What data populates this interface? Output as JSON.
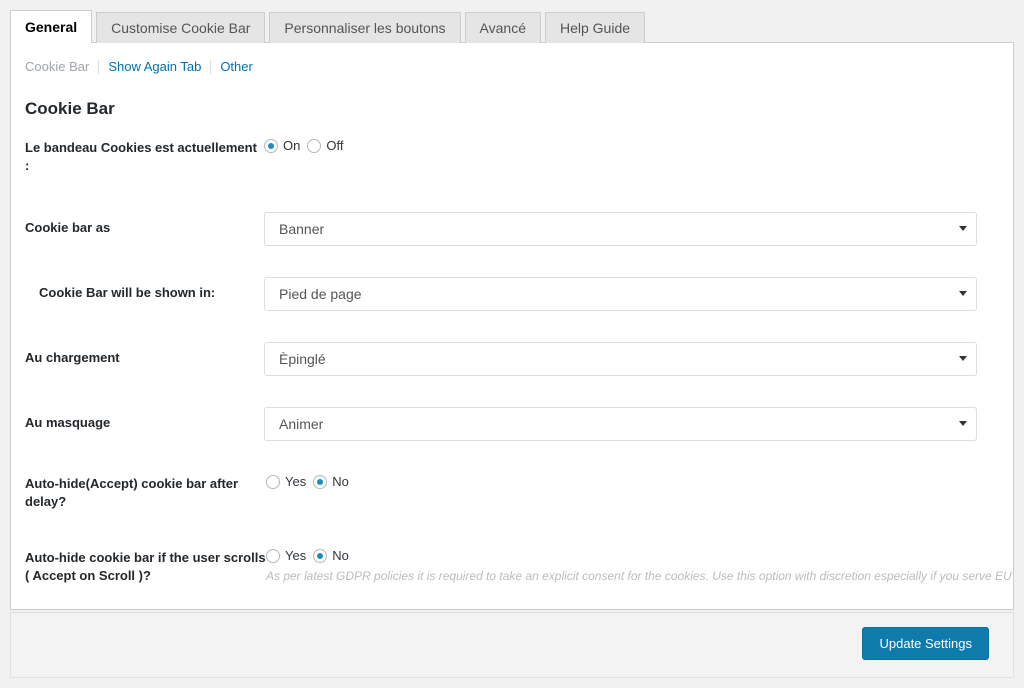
{
  "tabs": [
    {
      "label": "General",
      "active": true
    },
    {
      "label": "Customise Cookie Bar",
      "active": false
    },
    {
      "label": "Personnaliser les boutons",
      "active": false
    },
    {
      "label": "Avancé",
      "active": false
    },
    {
      "label": "Help Guide",
      "active": false
    }
  ],
  "subnav": [
    {
      "label": "Cookie Bar",
      "current": true
    },
    {
      "label": "Show Again Tab",
      "current": false
    },
    {
      "label": "Other",
      "current": false
    }
  ],
  "panel": {
    "title": "Cookie Bar"
  },
  "rows": {
    "status": {
      "label": "Le bandeau Cookies est actuellement :",
      "options": [
        "On",
        "Off"
      ],
      "selected": "On"
    },
    "cookie_bar_as": {
      "label": "Cookie bar as",
      "value": "Banner"
    },
    "shown_in": {
      "label": "Cookie Bar will be shown in:",
      "value": "Pied de page"
    },
    "on_load": {
      "label": "Au chargement",
      "value": "Èpinglé"
    },
    "on_hide": {
      "label": "Au masquage",
      "value": "Animer"
    },
    "auto_hide_delay": {
      "label": "Auto-hide(Accept) cookie bar after delay?",
      "options": [
        "Yes",
        "No"
      ],
      "selected": "No"
    },
    "auto_hide_scroll": {
      "label": "Auto-hide cookie bar if the user scrolls ( Accept on Scroll )?",
      "options": [
        "Yes",
        "No"
      ],
      "selected": "No",
      "help": "As per latest GDPR policies it is required to take an explicit consent for the cookies. Use this option with discretion especially if you serve EU"
    }
  },
  "footer": {
    "update_label": "Update Settings"
  },
  "colors": {
    "accent": "#0f7bad",
    "link": "#0073aa",
    "radio_dot": "#1e8cbe",
    "page_bg": "#f1f1f1",
    "heading": "#23282d"
  }
}
